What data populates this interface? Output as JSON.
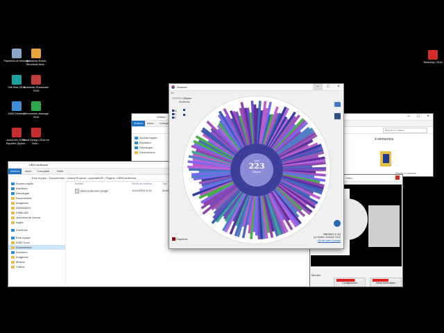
{
  "desktop": {
    "icons_left": [
      {
        "label": "Papelera de reciclaje",
        "color": "#8aa7c9"
      },
      {
        "label": "Autodesk Robot Structural Anal...",
        "color": "#e8a63a"
      },
      {
        "label": "3ds Max 2015",
        "color": "#1aa3a3"
      },
      {
        "label": "Autodesk Showcase 2016",
        "color": "#c23b3b"
      },
      {
        "label": "A360 Desktop",
        "color": "#3a8fd6"
      },
      {
        "label": "Recreación Manage 2016",
        "color": "#2aa84a"
      },
      {
        "label": "AutoCAD 2016 - Español (Spani...",
        "color": "#c62d2d"
      },
      {
        "label": "Revit Design 2016 en Auto...",
        "color": "#c62d2d"
      }
    ],
    "icon_right": {
      "label": "SketchUp 2015",
      "color": "#d12a2a"
    }
  },
  "explorer_back": {
    "title": "Videos",
    "tabs": [
      "Archivo",
      "Inicio",
      "Compartir",
      "Vista"
    ],
    "search_placeholder": "Buscar en Videos",
    "nav": [
      "Acceso rápido",
      "Escritorio",
      "Descargas",
      "Documentos"
    ],
    "count": "4 elementos",
    "right_caption": "Recibir un conector"
  },
  "explorer_front": {
    "title": "UBXCardboard",
    "tabs": [
      "Archivo",
      "Inicio",
      "Compartir",
      "Vista"
    ],
    "path": [
      "Este equipo",
      "Documentos",
      "Unreal Projects",
      "proboatsVR",
      "Plugins",
      "UBXCardboard"
    ],
    "columns": [
      "Nombre",
      "Fecha de modifica...",
      "Tipo"
    ],
    "files": [
      {
        "name": "UBXCardboard.uplugin",
        "date": "11/24/2015 5:16",
        "type": "Archivo"
      }
    ],
    "nav": [
      "Acceso rápido",
      "Escritorio",
      "Descargas",
      "Documentos",
      "Imágenes",
      "ANIMANDO",
      "FAMILIAS",
      "JuanVicente Unreal",
      "Inglés",
      "OneDrive",
      "Este equipo",
      "A360 Drive",
      "Documentos",
      "Escritorio",
      "Imágenes",
      "Música",
      "Vídeos"
    ]
  },
  "scanner": {
    "title": "Scanner",
    "legend": {
      "gb_label": "GBytes",
      "files_label": "Archivos"
    },
    "drives": [
      "G:",
      "E:",
      "Z:"
    ],
    "center": {
      "top": "total",
      "value": "223",
      "unit": "GBytes"
    },
    "recycle": "Papelera",
    "version": "Version 2.12",
    "copyright": "(c) Steffen Gerlach 2012",
    "links": "On the web | Donate"
  },
  "stream_window": {
    "title": "ZOD - video",
    "buttons": [
      "Configuración",
      "Iniciar transmisión"
    ],
    "label": "Monitor"
  },
  "colors": {
    "accent": "#1a73c9",
    "folder": "#e7bd4a"
  }
}
